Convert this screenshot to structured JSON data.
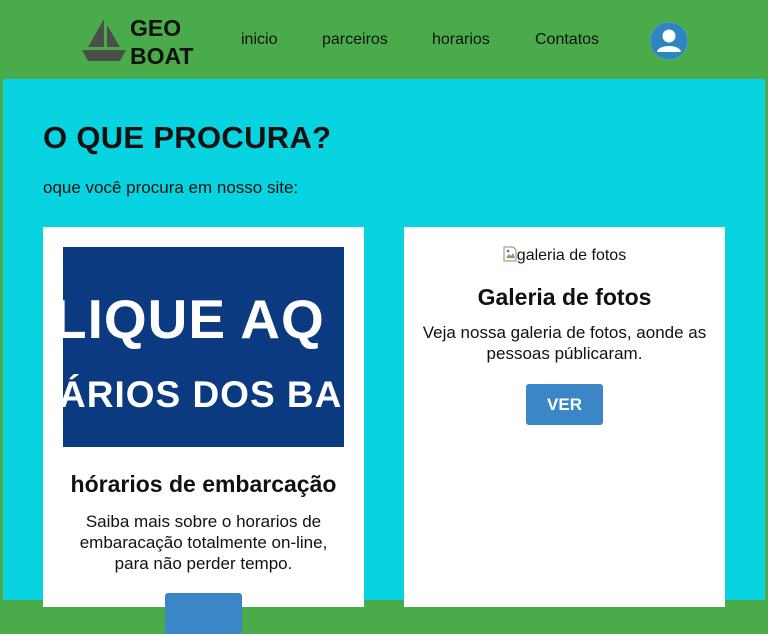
{
  "header": {
    "logo_line1": "GEO",
    "logo_line2": "BOAT",
    "nav": [
      {
        "label": "inicio"
      },
      {
        "label": "parceiros"
      },
      {
        "label": "horarios"
      },
      {
        "label": "Contatos"
      }
    ],
    "avatar_icon": "user-icon"
  },
  "main": {
    "title": "O QUE PROCURA?",
    "subtitle": "oque você procura em nosso site:",
    "cards": [
      {
        "banner_line1": "LIQUE AQ",
        "banner_line2": "ÁRIOS DOS BAR",
        "title": "hórarios de embarcação",
        "text": "Saiba mais sobre o horarios de embaracação totalmente on-line, para não perder tempo."
      },
      {
        "image_alt": "galeria de fotos",
        "title": "Galeria de fotos",
        "text": "Veja nossa galeria de fotos, aonde as pessoas públicaram.",
        "button_label": "VER"
      }
    ]
  },
  "colors": {
    "header_bg": "#4aab4a",
    "main_bg": "#08d4e1",
    "button": "#3b86c6",
    "banner": "#0c3a80",
    "avatar_icon": "#2e86c1"
  }
}
